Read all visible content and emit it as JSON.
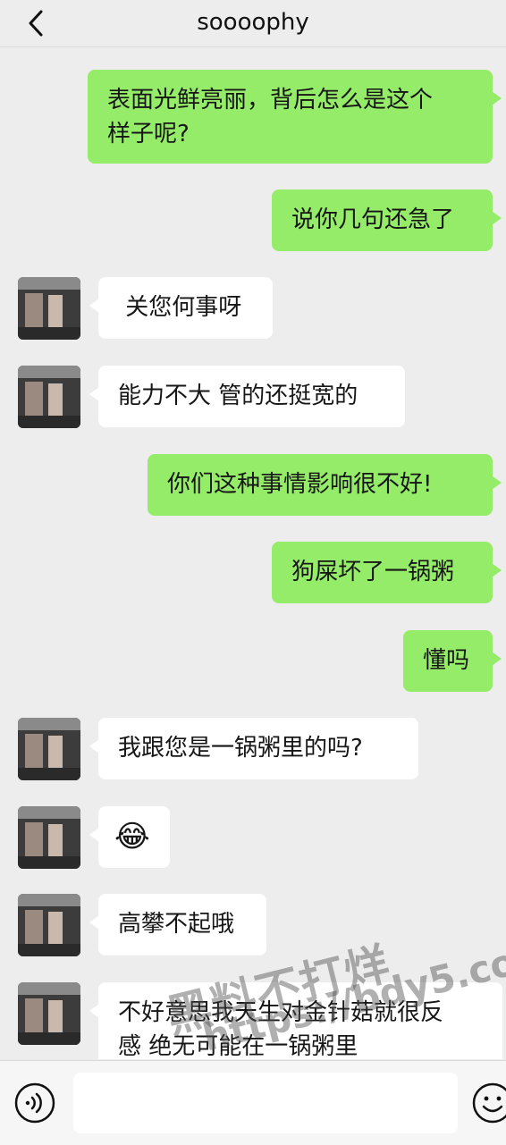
{
  "header": {
    "title": "soooophy",
    "back_icon": "chevron-left-icon"
  },
  "messages": [
    {
      "side": "out",
      "text": "表面光鲜亮丽，背后怎么是这个\n样子呢?"
    },
    {
      "side": "out",
      "text": "说你几句还急了"
    },
    {
      "side": "in",
      "text": " 关您何事呀"
    },
    {
      "side": "in",
      "text": "能力不大 管的还挺宽的"
    },
    {
      "side": "out",
      "text": "你们这种事情影响很不好!"
    },
    {
      "side": "out",
      "text": "狗屎坏了一锅粥"
    },
    {
      "side": "out",
      "text": "懂吗"
    },
    {
      "side": "in",
      "text": "我跟您是一锅粥里的吗?"
    },
    {
      "side": "in",
      "text": "😂",
      "emoji": "face-with-tears-of-joy"
    },
    {
      "side": "in",
      "text": "高攀不起哦"
    },
    {
      "side": "in",
      "text": "不好意思我天生对金针菇就很反\n感 绝无可能在一锅粥里"
    }
  ],
  "input_bar": {
    "voice_icon": "voice-icon",
    "emoji_icon": "emoji-icon",
    "field_value": ""
  },
  "watermark": {
    "line1": "黑料不打烊",
    "line2": "https://bdy5.co"
  },
  "colors": {
    "outgoing": "#95ec69",
    "incoming": "#ffffff",
    "background": "#ededed"
  }
}
